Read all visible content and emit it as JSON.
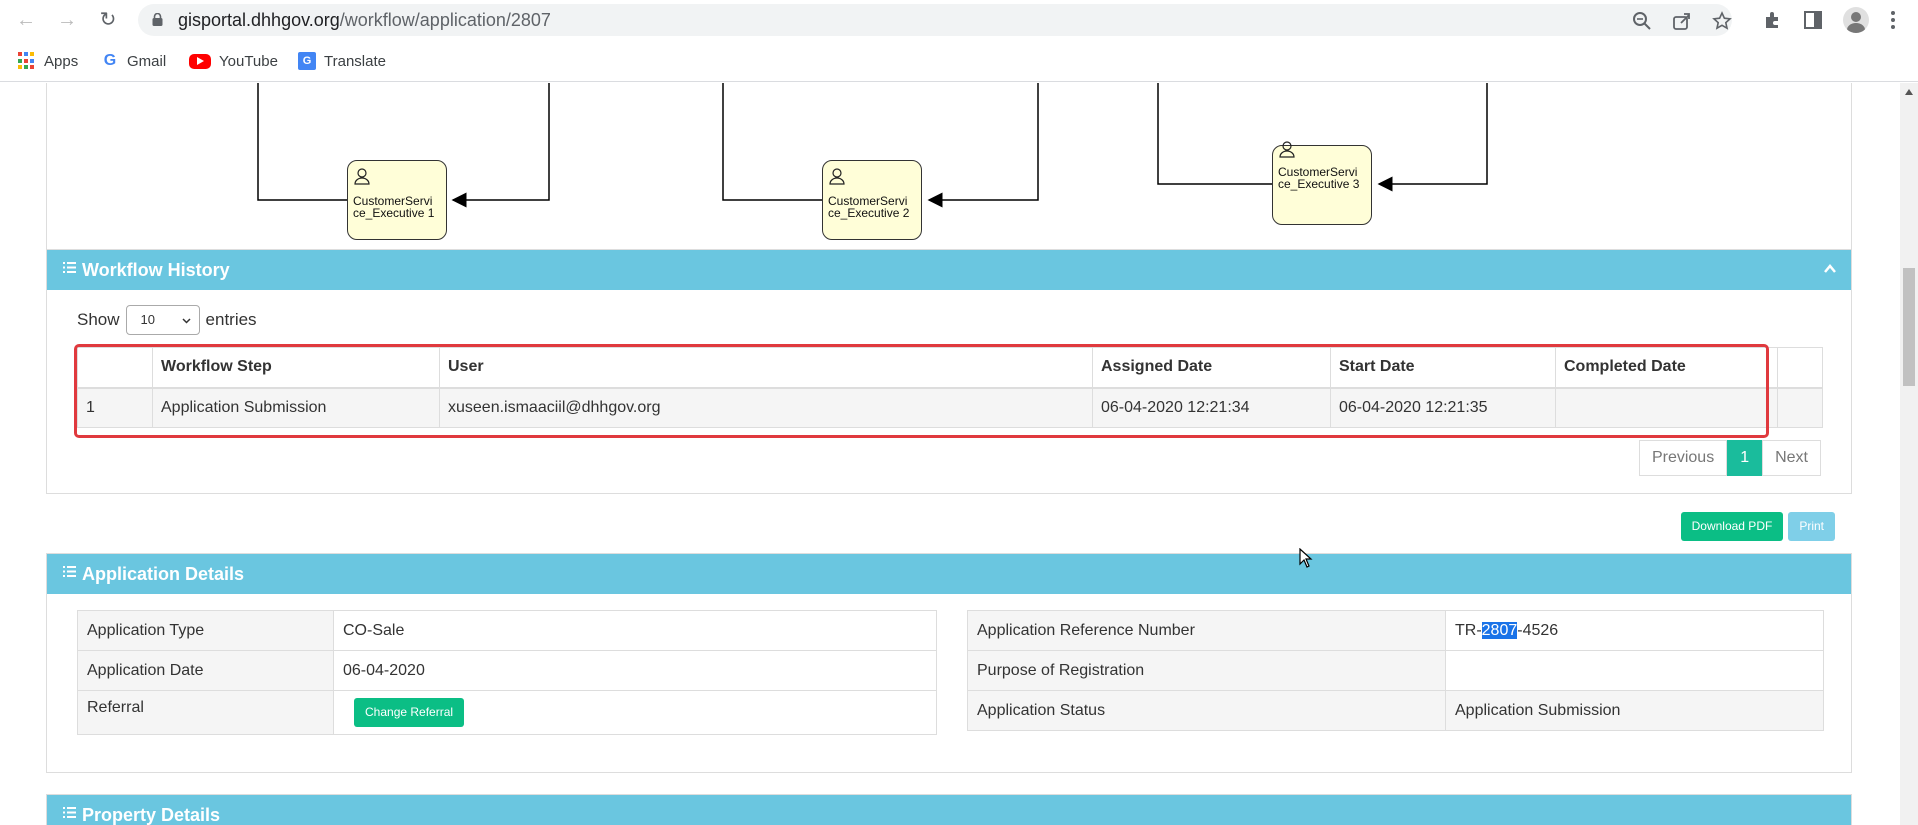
{
  "browser": {
    "url_host": "gisportal.dhhgov.org",
    "url_path": "/workflow/application/2807",
    "bookmarks": [
      {
        "label": "Apps",
        "icon": "apps-grid-icon"
      },
      {
        "label": "Gmail",
        "icon": "google-icon"
      },
      {
        "label": "YouTube",
        "icon": "youtube-icon"
      },
      {
        "label": "Translate",
        "icon": "translate-icon"
      }
    ],
    "google_letter": "G",
    "translate_letter": "G"
  },
  "diagram": {
    "tasks": [
      {
        "label": "CustomerServi\nce_Executive 1"
      },
      {
        "label": "CustomerServi\nce_Executive 2"
      },
      {
        "label": "CustomerServi\nce_Executive 3"
      }
    ]
  },
  "workflow_history": {
    "title": "Workflow History",
    "show_label": "Show",
    "entries_value": "10",
    "entries_label": "entries",
    "columns": [
      "",
      "Workflow Step",
      "User",
      "Assigned Date",
      "Start Date",
      "Completed Date",
      ""
    ],
    "rows": [
      [
        "1",
        "Application Submission",
        "xuseen.ismaaciil@dhhgov.org",
        "06-04-2020 12:21:34",
        "06-04-2020 12:21:35",
        "",
        ""
      ]
    ],
    "pager": {
      "previous": "Previous",
      "page": "1",
      "next": "Next"
    }
  },
  "actions": {
    "download_pdf": "Download PDF",
    "print": "Print"
  },
  "application_details": {
    "title": "Application Details",
    "left": {
      "type_label": "Application Type",
      "type_value": "CO-Sale",
      "date_label": "Application Date",
      "date_value": "06-04-2020",
      "referral_label": "Referral",
      "change_referral": "Change Referral"
    },
    "right": {
      "ref_label": "Application Reference Number",
      "ref_prefix": "TR-",
      "ref_selected": "2807",
      "ref_suffix": "-4526",
      "purpose_label": "Purpose of Registration",
      "purpose_value": "",
      "status_label": "Application Status",
      "status_value": "Application Submission"
    }
  },
  "property_details": {
    "title": "Property Details"
  },
  "colors": {
    "panel_header": "#6ac6e0",
    "accent_green": "#0bbe85",
    "active_page": "#1abc9c",
    "highlight_box": "#e0393e"
  }
}
